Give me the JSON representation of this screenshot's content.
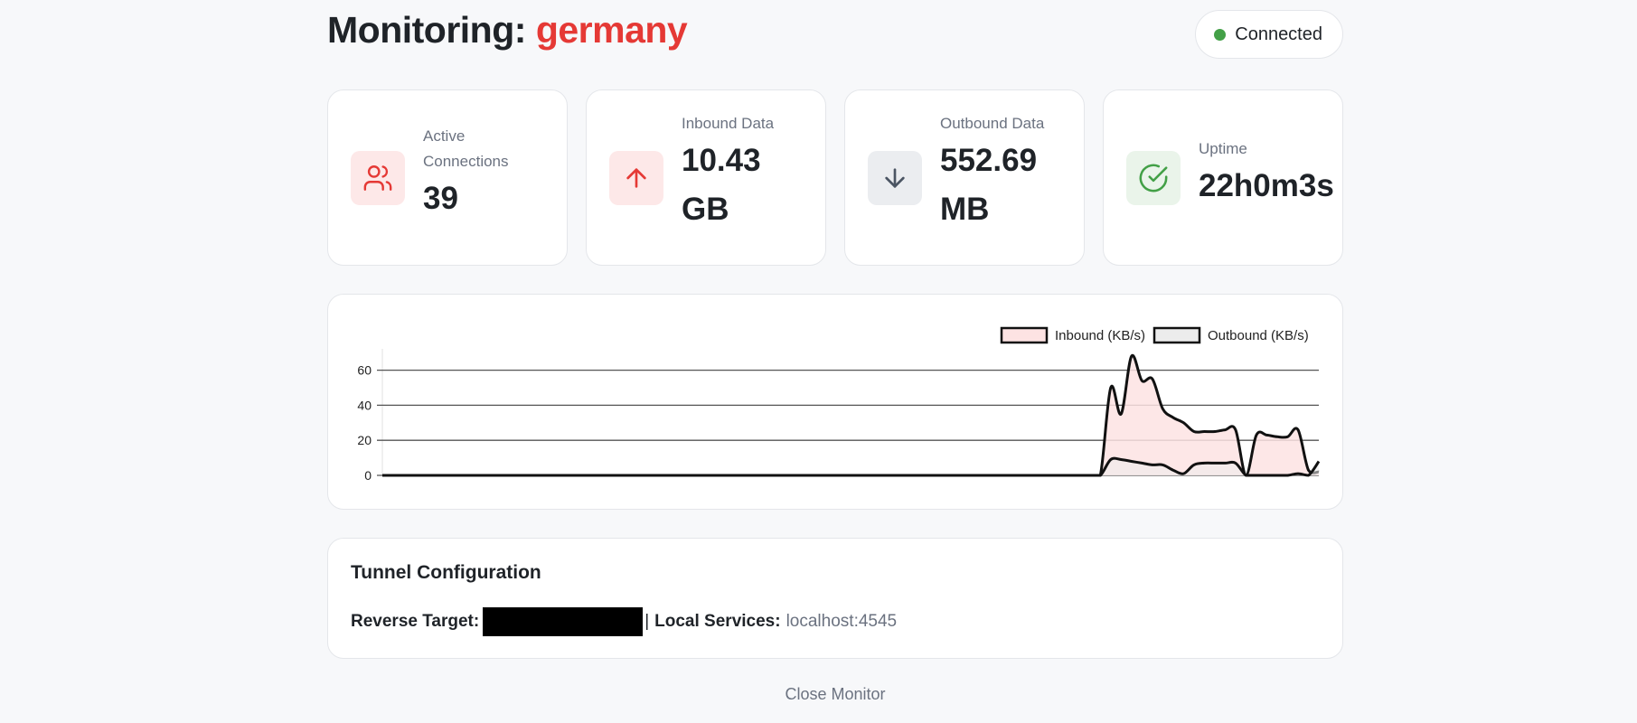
{
  "header": {
    "title_prefix": "Monitoring: ",
    "location": "germany",
    "status": "Connected",
    "status_color": "#43a047",
    "accent_color": "#e53935"
  },
  "stats": [
    {
      "label": "Active Connections",
      "value": "39",
      "icon": "users-icon"
    },
    {
      "label": "Inbound Data",
      "value": "10.43 GB",
      "icon": "arrow-up-icon"
    },
    {
      "label": "Outbound Data",
      "value": "552.69 MB",
      "icon": "arrow-down-icon"
    },
    {
      "label": "Uptime",
      "value": "22h0m3s",
      "icon": "check-circle-icon"
    }
  ],
  "chart_data": {
    "type": "area",
    "title": "",
    "xlabel": "",
    "ylabel": "",
    "ylim": [
      0,
      70
    ],
    "yticks": [
      0,
      20,
      40,
      60
    ],
    "grid": true,
    "legend": "top-right",
    "series": [
      {
        "name": "Inbound (KB/s)",
        "color": "#fde3e3",
        "values": [
          0,
          0,
          0,
          0,
          0,
          0,
          0,
          0,
          0,
          0,
          0,
          0,
          0,
          0,
          0,
          0,
          0,
          0,
          0,
          0,
          0,
          0,
          0,
          0,
          0,
          0,
          0,
          0,
          0,
          0,
          0,
          0,
          0,
          0,
          0,
          0,
          0,
          0,
          0,
          0,
          0,
          0,
          0,
          0,
          0,
          0,
          0,
          0,
          0,
          0,
          0,
          0,
          0,
          0,
          0,
          0,
          0,
          0,
          0,
          0,
          0,
          0,
          0,
          0,
          0,
          0,
          0,
          0,
          0,
          0,
          50,
          35,
          68,
          54,
          55,
          38,
          33,
          30,
          25,
          25,
          25,
          26,
          26,
          0,
          23,
          23,
          22,
          22,
          26,
          3,
          2
        ]
      },
      {
        "name": "Outbound (KB/s)",
        "color": "#ececec",
        "values": [
          0,
          0,
          0,
          0,
          0,
          0,
          0,
          0,
          0,
          0,
          0,
          0,
          0,
          0,
          0,
          0,
          0,
          0,
          0,
          0,
          0,
          0,
          0,
          0,
          0,
          0,
          0,
          0,
          0,
          0,
          0,
          0,
          0,
          0,
          0,
          0,
          0,
          0,
          0,
          0,
          0,
          0,
          0,
          0,
          0,
          0,
          0,
          0,
          0,
          0,
          0,
          0,
          0,
          0,
          0,
          0,
          0,
          0,
          0,
          0,
          0,
          0,
          0,
          0,
          0,
          0,
          0,
          0,
          0,
          0,
          9,
          9,
          8,
          7,
          6,
          6,
          3,
          1,
          6,
          7,
          7,
          7,
          7,
          0,
          0,
          0,
          0,
          0,
          1,
          0,
          8
        ]
      }
    ]
  },
  "config": {
    "title": "Tunnel Configuration",
    "reverse_label": "Reverse Target:",
    "separator": "|",
    "local_label": "Local Services:",
    "local_value": "localhost:4545"
  },
  "footer": {
    "close_label": "Close Monitor"
  }
}
